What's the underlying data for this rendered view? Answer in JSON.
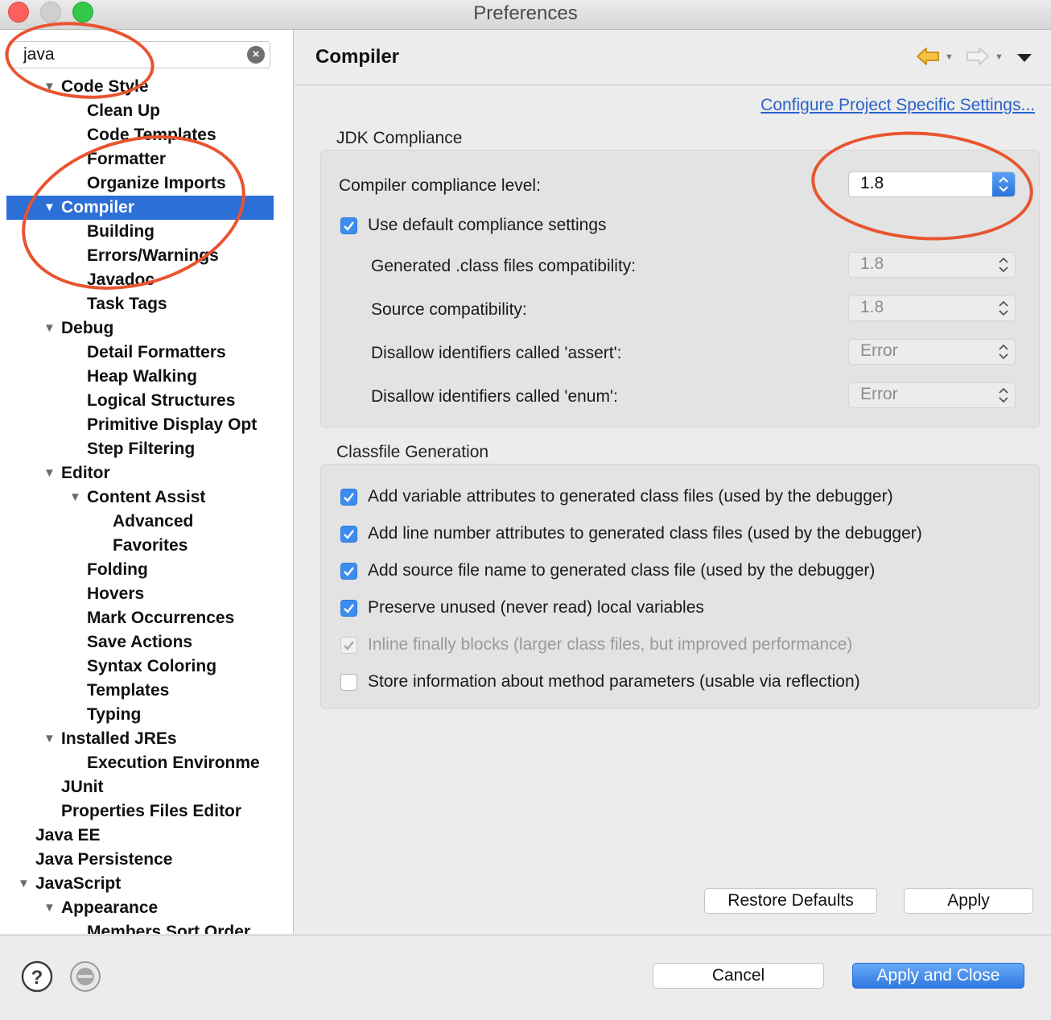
{
  "window": {
    "title": "Preferences",
    "traffic_lights": [
      "close",
      "minimize",
      "zoom"
    ]
  },
  "sidebar": {
    "filter": {
      "value": "java",
      "clear_icon": "clear-circle-icon"
    },
    "tree": [
      {
        "label": "Code Style",
        "level": 1,
        "expanded": true
      },
      {
        "label": "Clean Up",
        "level": 2
      },
      {
        "label": "Code Templates",
        "level": 2
      },
      {
        "label": "Formatter",
        "level": 2
      },
      {
        "label": "Organize Imports",
        "level": 2
      },
      {
        "label": "Compiler",
        "level": 1,
        "expanded": true,
        "selected": true
      },
      {
        "label": "Building",
        "level": 2
      },
      {
        "label": "Errors/Warnings",
        "level": 2
      },
      {
        "label": "Javadoc",
        "level": 2
      },
      {
        "label": "Task Tags",
        "level": 2
      },
      {
        "label": "Debug",
        "level": 1,
        "expanded": true
      },
      {
        "label": "Detail Formatters",
        "level": 2
      },
      {
        "label": "Heap Walking",
        "level": 2
      },
      {
        "label": "Logical Structures",
        "level": 2
      },
      {
        "label": "Primitive Display Opt",
        "level": 2
      },
      {
        "label": "Step Filtering",
        "level": 2
      },
      {
        "label": "Editor",
        "level": 1,
        "expanded": true
      },
      {
        "label": "Content Assist",
        "level": 2,
        "expanded": true
      },
      {
        "label": "Advanced",
        "level": 3
      },
      {
        "label": "Favorites",
        "level": 3
      },
      {
        "label": "Folding",
        "level": 2
      },
      {
        "label": "Hovers",
        "level": 2
      },
      {
        "label": "Mark Occurrences",
        "level": 2
      },
      {
        "label": "Save Actions",
        "level": 2
      },
      {
        "label": "Syntax Coloring",
        "level": 2
      },
      {
        "label": "Templates",
        "level": 2
      },
      {
        "label": "Typing",
        "level": 2
      },
      {
        "label": "Installed JREs",
        "level": 1,
        "expanded": true
      },
      {
        "label": "Execution Environme",
        "level": 2
      },
      {
        "label": "JUnit",
        "level": 1
      },
      {
        "label": "Properties Files Editor",
        "level": 1
      },
      {
        "label": "Java EE",
        "level": 0
      },
      {
        "label": "Java Persistence",
        "level": 0
      },
      {
        "label": "JavaScript",
        "level": 0,
        "expanded": true
      },
      {
        "label": "Appearance",
        "level": 1,
        "expanded": true
      },
      {
        "label": "Members Sort Order",
        "level": 2
      }
    ]
  },
  "header": {
    "title": "Compiler",
    "back_icon": "back-arrow-icon",
    "forward_icon": "forward-arrow-icon",
    "menu_icon": "view-menu-icon"
  },
  "main": {
    "config_link": "Configure Project Specific Settings...",
    "jdk": {
      "title": "JDK Compliance",
      "compliance_label": "Compiler compliance level:",
      "compliance_value": "1.8",
      "use_default_label": "Use default compliance settings",
      "use_default_checked": true,
      "rows": [
        {
          "label": "Generated .class files compatibility:",
          "value": "1.8"
        },
        {
          "label": "Source compatibility:",
          "value": "1.8"
        },
        {
          "label": "Disallow identifiers called 'assert':",
          "value": "Error"
        },
        {
          "label": "Disallow identifiers called 'enum':",
          "value": "Error"
        }
      ]
    },
    "classfile": {
      "title": "Classfile Generation",
      "options": [
        {
          "label": "Add variable attributes to generated class files (used by the debugger)",
          "checked": true,
          "enabled": true
        },
        {
          "label": "Add line number attributes to generated class files (used by the debugger)",
          "checked": true,
          "enabled": true
        },
        {
          "label": "Add source file name to generated class file (used by the debugger)",
          "checked": true,
          "enabled": true
        },
        {
          "label": "Preserve unused (never read) local variables",
          "checked": true,
          "enabled": true
        },
        {
          "label": "Inline finally blocks (larger class files, but improved performance)",
          "checked": true,
          "enabled": false
        },
        {
          "label": "Store information about method parameters (usable via reflection)",
          "checked": false,
          "enabled": true
        }
      ]
    },
    "restore_defaults_label": "Restore Defaults",
    "apply_label": "Apply"
  },
  "footer": {
    "help_icon": "help-icon",
    "import_export_icon": "import-export-icon",
    "cancel_label": "Cancel",
    "apply_close_label": "Apply and Close"
  },
  "colors": {
    "selection": "#2c6fd6",
    "link": "#2a62c9",
    "annotation": "#e8542f",
    "checkbox": "#3d8cf0"
  }
}
